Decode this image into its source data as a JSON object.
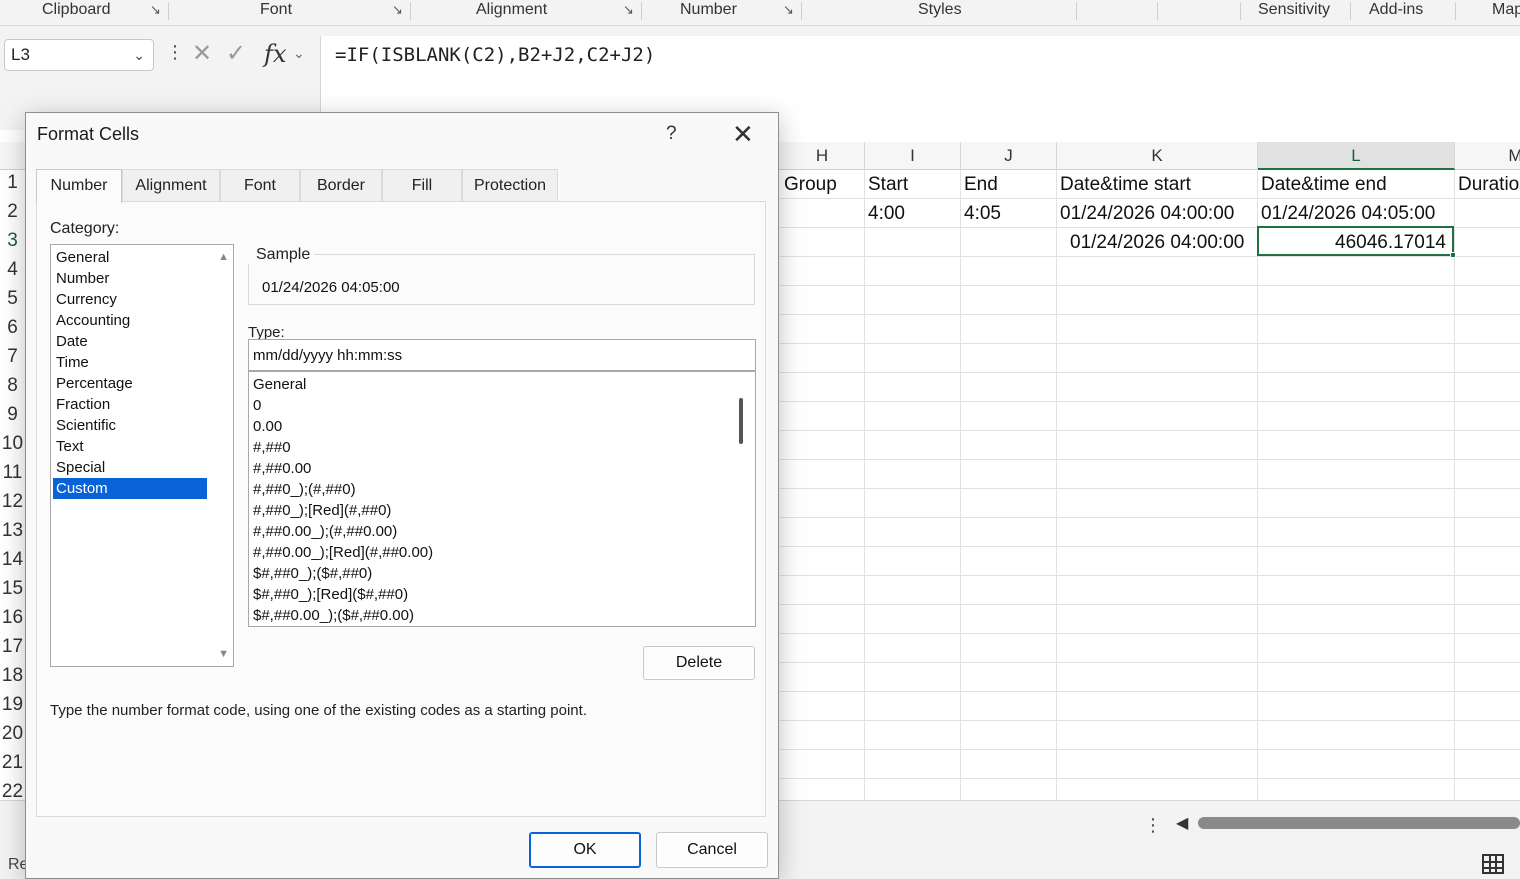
{
  "ribbon": {
    "groups": [
      "Clipboard",
      "Font",
      "Alignment",
      "Number",
      "Styles",
      "Sensitivity",
      "Add-ins",
      "Map"
    ]
  },
  "formula_bar": {
    "name_box": "L3",
    "formula": "=IF(ISBLANK(C2),B2+J2,C2+J2)"
  },
  "grid": {
    "columns": [
      "H",
      "I",
      "J",
      "K",
      "L",
      "M"
    ],
    "selected_column": "L",
    "rows": [
      "1",
      "2",
      "3",
      "4",
      "5",
      "6",
      "7",
      "8",
      "9",
      "10",
      "11",
      "12",
      "13",
      "14",
      "15",
      "16",
      "17",
      "18",
      "19",
      "20",
      "21",
      "22"
    ],
    "selected_row": "3",
    "cells": {
      "h1": "Group",
      "i1": "Start",
      "j1": "End",
      "k1": "Date&time start",
      "l1": "Date&time end",
      "m1": "Duratio",
      "i2": "4:00",
      "j2": "4:05",
      "k2": "01/24/2026 04:00:00",
      "l2": "01/24/2026 04:05:00",
      "k3": "01/24/2026 04:00:00",
      "l3": "46046.17014"
    }
  },
  "status": {
    "mode_text": "Re"
  },
  "dialog": {
    "title": "Format Cells",
    "help": "?",
    "tabs": [
      "Number",
      "Alignment",
      "Font",
      "Border",
      "Fill",
      "Protection"
    ],
    "active_tab": "Number",
    "category_label": "Category:",
    "categories": [
      "General",
      "Number",
      "Currency",
      "Accounting",
      "Date",
      "Time",
      "Percentage",
      "Fraction",
      "Scientific",
      "Text",
      "Special",
      "Custom"
    ],
    "selected_category": "Custom",
    "sample_label": "Sample",
    "sample_value": "01/24/2026 04:05:00",
    "type_label": "Type:",
    "type_value": "mm/dd/yyyy hh:mm:ss",
    "type_list": [
      "General",
      "0",
      "0.00",
      "#,##0",
      "#,##0.00",
      "#,##0_);(#,##0)",
      "#,##0_);[Red](#,##0)",
      "#,##0.00_);(#,##0.00)",
      "#,##0.00_);[Red](#,##0.00)",
      "$#,##0_);($#,##0)",
      "$#,##0_);[Red]($#,##0)",
      "$#,##0.00_);($#,##0.00)"
    ],
    "delete_label": "Delete",
    "hint": "Type the number format code, using one of the existing codes as a starting point.",
    "ok_label": "OK",
    "cancel_label": "Cancel"
  }
}
